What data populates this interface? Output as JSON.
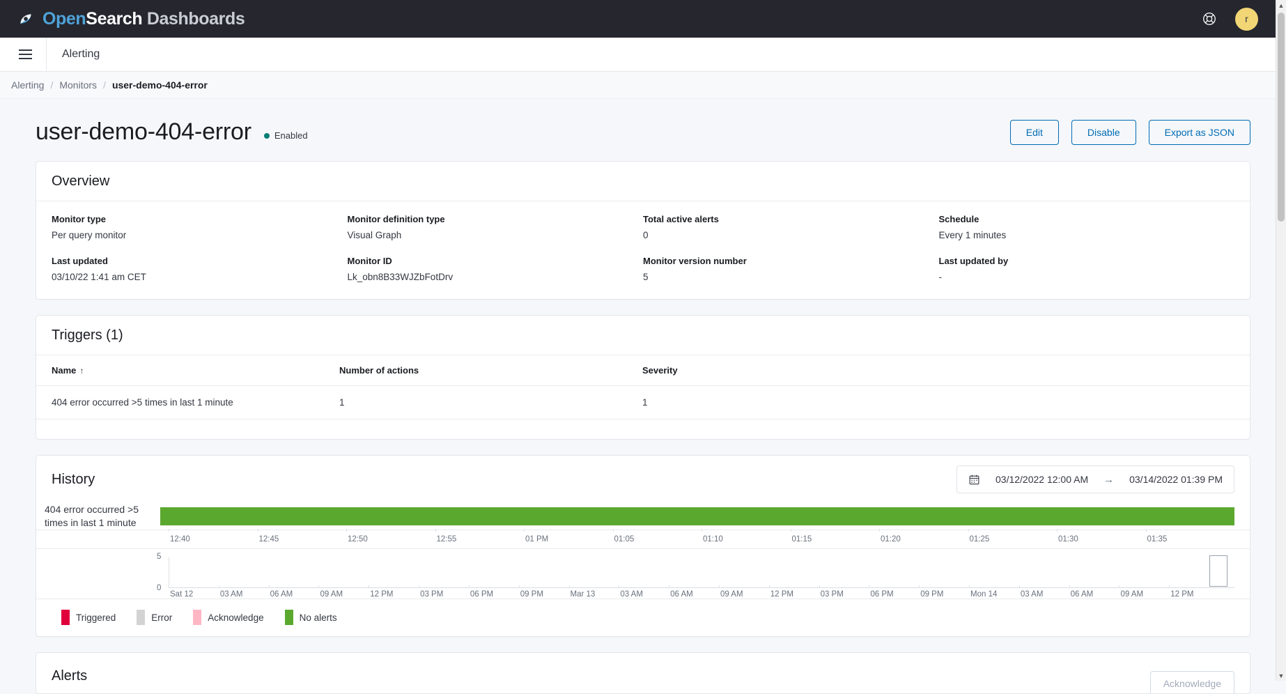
{
  "topbar": {
    "brand_part1": "Open",
    "brand_part2": "Search",
    "brand_part3": " Dashboards",
    "help_icon": "help-lifebuoy-icon",
    "avatar_initial": "r"
  },
  "nav": {
    "menu_icon": "hamburger-menu-icon",
    "title": "Alerting"
  },
  "breadcrumb": {
    "items": [
      "Alerting",
      "Monitors",
      "user-demo-404-error"
    ],
    "separator": "/"
  },
  "header": {
    "title": "user-demo-404-error",
    "status": "Enabled",
    "status_color": "#017d73",
    "buttons": [
      {
        "label": "Edit"
      },
      {
        "label": "Disable"
      },
      {
        "label": "Export as JSON"
      }
    ]
  },
  "overview": {
    "title": "Overview",
    "fields": [
      {
        "label": "Monitor type",
        "value": "Per query monitor"
      },
      {
        "label": "Monitor definition type",
        "value": "Visual Graph"
      },
      {
        "label": "Total active alerts",
        "value": "0"
      },
      {
        "label": "Schedule",
        "value": "Every 1 minutes"
      },
      {
        "label": "Last updated",
        "value": "03/10/22 1:41 am CET"
      },
      {
        "label": "Monitor ID",
        "value": "Lk_obn8B33WJZbFotDrv"
      },
      {
        "label": "Monitor version number",
        "value": "5"
      },
      {
        "label": "Last updated by",
        "value": "-"
      }
    ]
  },
  "triggers": {
    "title": "Triggers (1)",
    "columns": [
      "Name",
      "Number of actions",
      "Severity"
    ],
    "sort_column": "Name",
    "sort_direction": "asc",
    "sort_arrow": "↑",
    "rows": [
      {
        "name": "404 error occurred >5 times in last 1 minute",
        "actions": "1",
        "severity": "1"
      }
    ]
  },
  "history": {
    "title": "History",
    "date_range": {
      "calendar_icon": "calendar-icon",
      "start": "03/12/2022 12:00 AM",
      "arrow": "→",
      "end": "03/14/2022 01:39 PM"
    },
    "trigger_label": "404 error occurred >5 times in last 1 minute",
    "timeline_status": "No alerts",
    "timeline_color": "#5ba82f",
    "detail_axis_ticks": [
      "12:40",
      "12:45",
      "12:50",
      "12:55",
      "01 PM",
      "01:05",
      "01:10",
      "01:15",
      "01:20",
      "01:25",
      "01:30",
      "01:35"
    ],
    "brush_y_ticks": [
      "5",
      "0"
    ],
    "brush_axis_ticks": [
      "Sat 12",
      "03 AM",
      "06 AM",
      "09 AM",
      "12 PM",
      "03 PM",
      "06 PM",
      "09 PM",
      "Mar 13",
      "03 AM",
      "06 AM",
      "09 AM",
      "12 PM",
      "03 PM",
      "06 PM",
      "09 PM",
      "Mon 14",
      "03 AM",
      "06 AM",
      "09 AM",
      "12 PM"
    ],
    "legend": [
      {
        "label": "Triggered",
        "color": "#e0003c"
      },
      {
        "label": "Error",
        "color": "#d3d3d3"
      },
      {
        "label": "Acknowledge",
        "color": "#ffb6c4"
      },
      {
        "label": "No alerts",
        "color": "#5ba82f"
      }
    ]
  },
  "alerts_panel": {
    "title": "Alerts",
    "acknowledge_button": "Acknowledge"
  },
  "chart_data": {
    "type": "bar",
    "title": "History",
    "xlabel": "",
    "ylabel": "",
    "ylim": [
      0,
      5
    ],
    "grid": false,
    "legend_position": "bottom",
    "categories": [
      "12:40",
      "12:45",
      "12:50",
      "12:55",
      "01 PM",
      "01:05",
      "01:10",
      "01:15",
      "01:20",
      "01:25",
      "01:30",
      "01:35"
    ],
    "series": [
      {
        "name": "404 error occurred >5 times in last 1 minute",
        "state": "No alerts",
        "color": "#5ba82f",
        "values": [
          1,
          1,
          1,
          1,
          1,
          1,
          1,
          1,
          1,
          1,
          1,
          1
        ]
      }
    ],
    "overview_axis": [
      "Sat 12",
      "03 AM",
      "06 AM",
      "09 AM",
      "12 PM",
      "03 PM",
      "06 PM",
      "09 PM",
      "Mar 13",
      "03 AM",
      "06 AM",
      "09 AM",
      "12 PM",
      "03 PM",
      "06 PM",
      "09 PM",
      "Mon 14",
      "03 AM",
      "06 AM",
      "09 AM",
      "12 PM"
    ],
    "overview_values": [
      0,
      0,
      0,
      0,
      0,
      0,
      0,
      0,
      0,
      0,
      0,
      0,
      0,
      0,
      0,
      0,
      0,
      0,
      0,
      0,
      0
    ],
    "brush_selection": [
      "03/14/2022 12:40 PM",
      "03/14/2022 01:39 PM"
    ]
  }
}
